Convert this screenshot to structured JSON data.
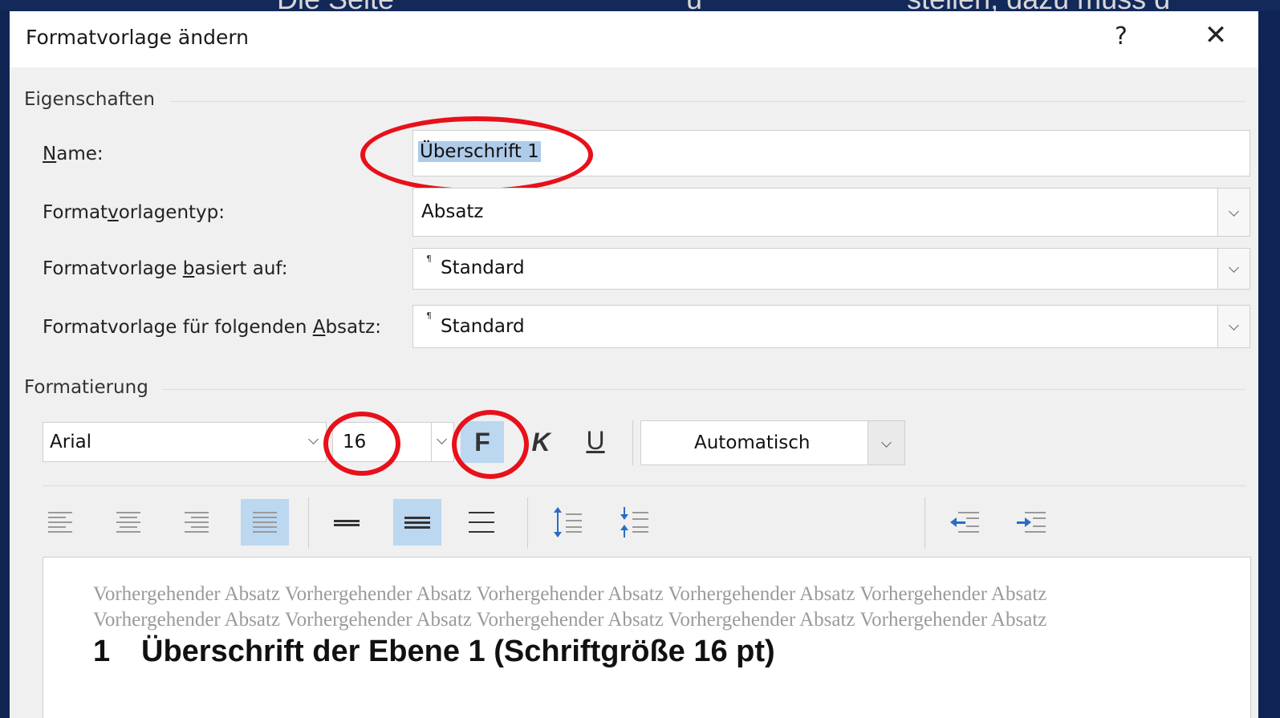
{
  "background": {
    "partial_text": [
      "Die Seite",
      "u",
      "stellen, dazu muss d"
    ]
  },
  "dialog": {
    "title": "Formatvorlage ändern",
    "help": "?",
    "close": "✕"
  },
  "properties": {
    "section_label": "Eigenschaften",
    "name": {
      "label_mn": "N",
      "label_rest": "ame:",
      "value": "Überschrift 1"
    },
    "style_type": {
      "label_pre": "Format",
      "label_mn": "v",
      "label_post": "orlagentyp:",
      "value": "Absatz"
    },
    "based_on": {
      "label_pre": "Formatvorlage ",
      "label_mn": "b",
      "label_post": "asiert auf:",
      "value": "Standard",
      "mark": "¶"
    },
    "next_style": {
      "label_pre": "Formatvorlage für folgenden ",
      "label_mn": "A",
      "label_post": "bsatz:",
      "value": "Standard",
      "mark": "¶"
    }
  },
  "formatting": {
    "section_label": "Formatierung",
    "font": "Arial",
    "size": "16",
    "bold": "F",
    "italic": "K",
    "underline": "U",
    "color": "Automatisch"
  },
  "preview": {
    "previous_text": "Vorhergehender Absatz Vorhergehender Absatz Vorhergehender Absatz Vorhergehender Absatz Vorhergehender Absatz Vorhergehender Absatz Vorhergehender Absatz Vorhergehender Absatz Vorhergehender Absatz Vorhergehender Absatz",
    "heading_number": "1",
    "heading_text": "Überschrift der Ebene 1 (Schriftgröße 16 pt)"
  },
  "colors": {
    "highlight_ring": "#e8101a",
    "pressed": "#bcd7f0",
    "selection": "#aecbe9"
  }
}
